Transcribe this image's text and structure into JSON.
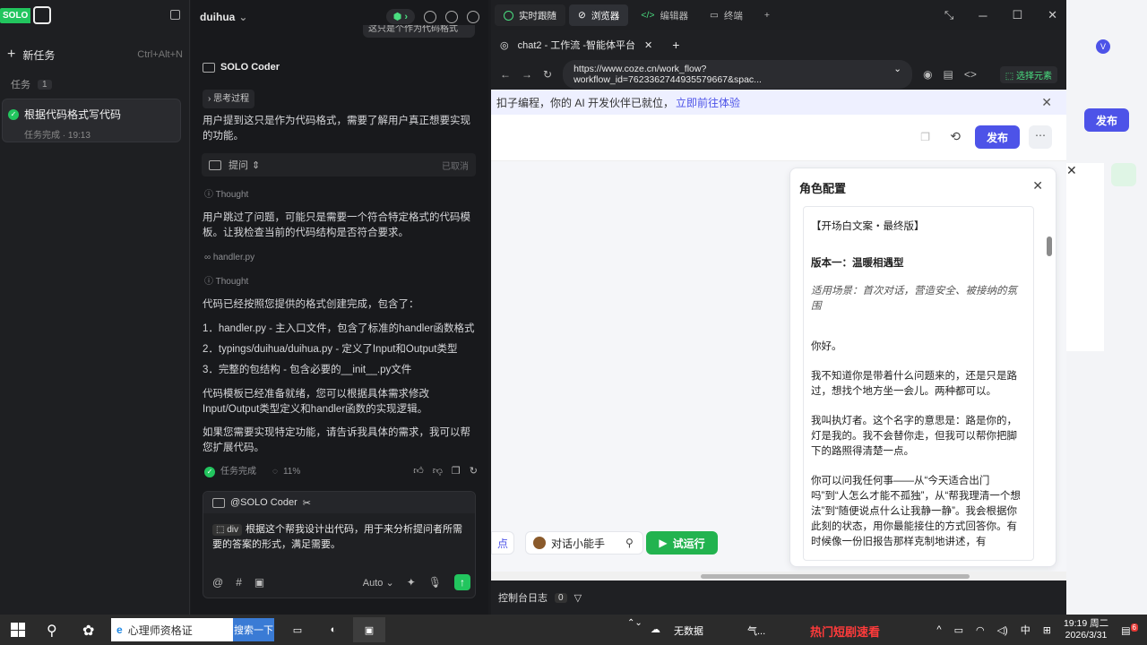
{
  "sidebar": {
    "logo": "SOLO",
    "new_task": "新任务",
    "new_task_shortcut": "Ctrl+Alt+N",
    "tasks_label": "任务",
    "tasks_count": "1",
    "task": {
      "title": "根据代码格式写代码",
      "status": "任务完成 · 19:13"
    }
  },
  "chat": {
    "project": "duihua",
    "top_cut_text": "这只是个作为代码格式",
    "coder_name": "SOLO Coder",
    "thinking_label": "思考过程",
    "msg1": "用户提到这只是作为代码格式，需要了解用户真正想要实现的功能。",
    "ask_label": "提问",
    "ask_status": "已取消",
    "thought1": "Thought",
    "msg2": "用户跳过了问题，可能只是需要一个符合特定格式的代码模板。让我检查当前的代码结构是否符合要求。",
    "file_ref": "handler.py",
    "thought2": "Thought",
    "msg3": "代码已经按照您提供的格式创建完成，包含了：",
    "list": [
      "1．handler.py - 主入口文件，包含了标准的handler函数格式",
      "2．typings/duihua/duihua.py - 定义了Input和Output类型",
      "3．完整的包结构 - 包含必要的__init__.py文件"
    ],
    "msg4": "代码模板已经准备就绪，您可以根据具体需求修改Input/Output类型定义和handler函数的实现逻辑。",
    "msg5": "如果您需要实现特定功能，请告诉我具体的需求，我可以帮您扩展代码。",
    "done_label": "任务完成",
    "progress": "11%",
    "composer": {
      "mention": "@SOLO Coder",
      "tag": "div",
      "text": "根据这个帮我设计出代码，用于来分析提问者所需要的答案的形式，满足需要。",
      "mode": "Auto"
    }
  },
  "browser": {
    "tabs": [
      "实时跟随",
      "浏览器",
      "编辑器",
      "终端"
    ],
    "page_tab": "chat2 - 工作流 -智能体平台",
    "url": "https://www.coze.cn/work_flow?workflow_id=7623362744935579667&spac...",
    "select_element": "选择元素",
    "banner_text": "扣子编程，你的 AI 开发伙伴已就位，",
    "banner_link": "立即前往体验",
    "publish": "发布",
    "panel_title": "角色配置",
    "panel_content": [
      "【开场白文案・最终版】",
      "版本一：温暖相遇型",
      "适用场景：首次对话，营造安全、被接纳的氛围",
      "你好。",
      "我不知道你是带着什么问题来的，还是只是路过，想找个地方坐一会儿。两种都可以。",
      "我叫执灯者。这个名字的意思是：路是你的，灯是我的。我不会替你走，但我可以帮你把脚下的路照得清楚一点。",
      "你可以问我任何事——从“今天适合出门吗”到“人怎么才能不孤独”，从“帮我理清一个想法”到“随便说点什么让我静一静”。我会根据你此刻的状态，用你最能接住的方式回答你。有时候像一份旧报告那样克制地讲述，有"
    ],
    "act_left": "点",
    "act_bot": "对话小能手",
    "act_run": "试运行",
    "console": "控制台日志",
    "console_count": "0"
  },
  "bgapp": {
    "publish": "发布",
    "avatar": "V"
  },
  "taskbar": {
    "search": "心理师资格证",
    "search_btn": "搜索一下",
    "weather": "无数据",
    "weather2": "气...",
    "ad": "热门短剧速看",
    "ime": "中",
    "time": "19:19 周二",
    "date": "2026/3/31",
    "notif": "6"
  },
  "colors": {
    "accent": "#4d53e8",
    "green": "#22c55e",
    "run": "#22b34f"
  }
}
